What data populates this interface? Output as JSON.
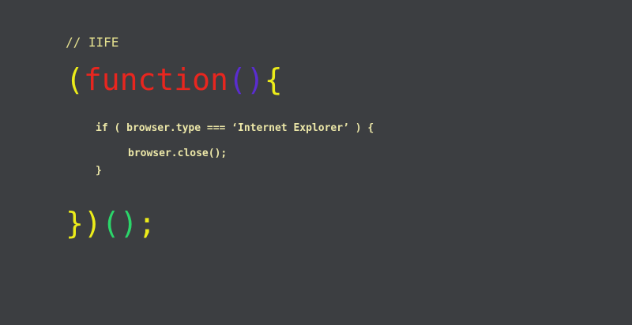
{
  "code": {
    "comment": "// IIFE",
    "open_paren": "(",
    "keyword": "function",
    "param_open": "(",
    "param_close": ")",
    "brace_open": "{",
    "if_line": "if ( browser.type === ‘Internet Explorer’ ) {",
    "call_line": "browser.close();",
    "inner_close": "}",
    "brace_close": "}",
    "wrap_close": ")",
    "invoke_open": "(",
    "invoke_close": ")",
    "semicolon": ";"
  },
  "colors": {
    "background": "#3c3e41",
    "comment": "#e4e08f",
    "yellow": "#ecec1a",
    "red": "#e8261f",
    "purple": "#5a2dcf",
    "green": "#2bd66a",
    "code_text": "#ece7a8"
  }
}
